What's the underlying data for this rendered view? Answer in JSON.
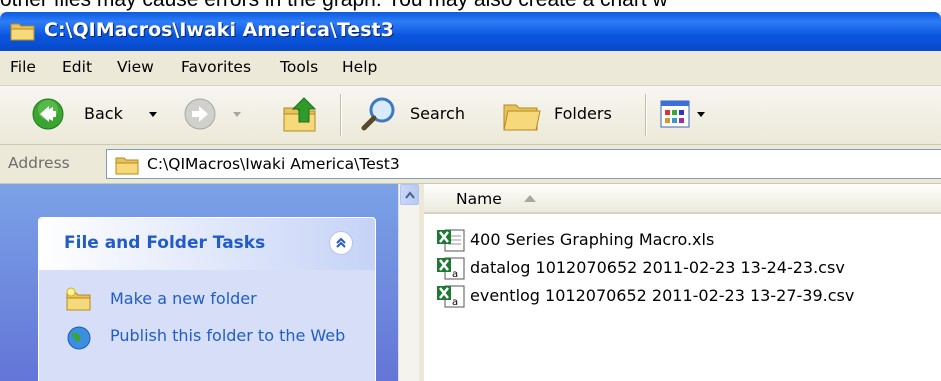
{
  "document": {
    "text_above": "other files may cause errors in the graph. You may also create a chart w"
  },
  "window": {
    "title": "C:\\QIMacros\\Iwaki America\\Test3",
    "title_icon": "folder-icon"
  },
  "menubar": {
    "items": [
      "File",
      "Edit",
      "View",
      "Favorites",
      "Tools",
      "Help"
    ]
  },
  "toolbar": {
    "back_label": "Back",
    "search_label": "Search",
    "folders_label": "Folders"
  },
  "address": {
    "label": "Address",
    "value": "C:\\QIMacros\\Iwaki America\\Test3"
  },
  "taskpane": {
    "title": "File and Folder Tasks",
    "items": [
      {
        "label": "Make a new folder",
        "icon": "new-folder-icon"
      },
      {
        "label": "Publish this folder to the Web",
        "icon": "globe-icon"
      }
    ]
  },
  "filelist": {
    "column_name": "Name",
    "sort": "ascending",
    "files": [
      {
        "name": "400 Series Graphing Macro.xls",
        "icon": "excel-icon"
      },
      {
        "name": "datalog 1012070652 2011-02-23 13-24-23.csv",
        "icon": "excel-csv-icon"
      },
      {
        "name": "eventlog 1012070652 2011-02-23 13-27-39.csv",
        "icon": "excel-csv-icon"
      }
    ]
  },
  "colors": {
    "titlebar": "#0a5ce0",
    "chrome": "#ece9d8",
    "taskpane_link": "#215dc6",
    "taskpane_bg": "#7ba2e7"
  }
}
